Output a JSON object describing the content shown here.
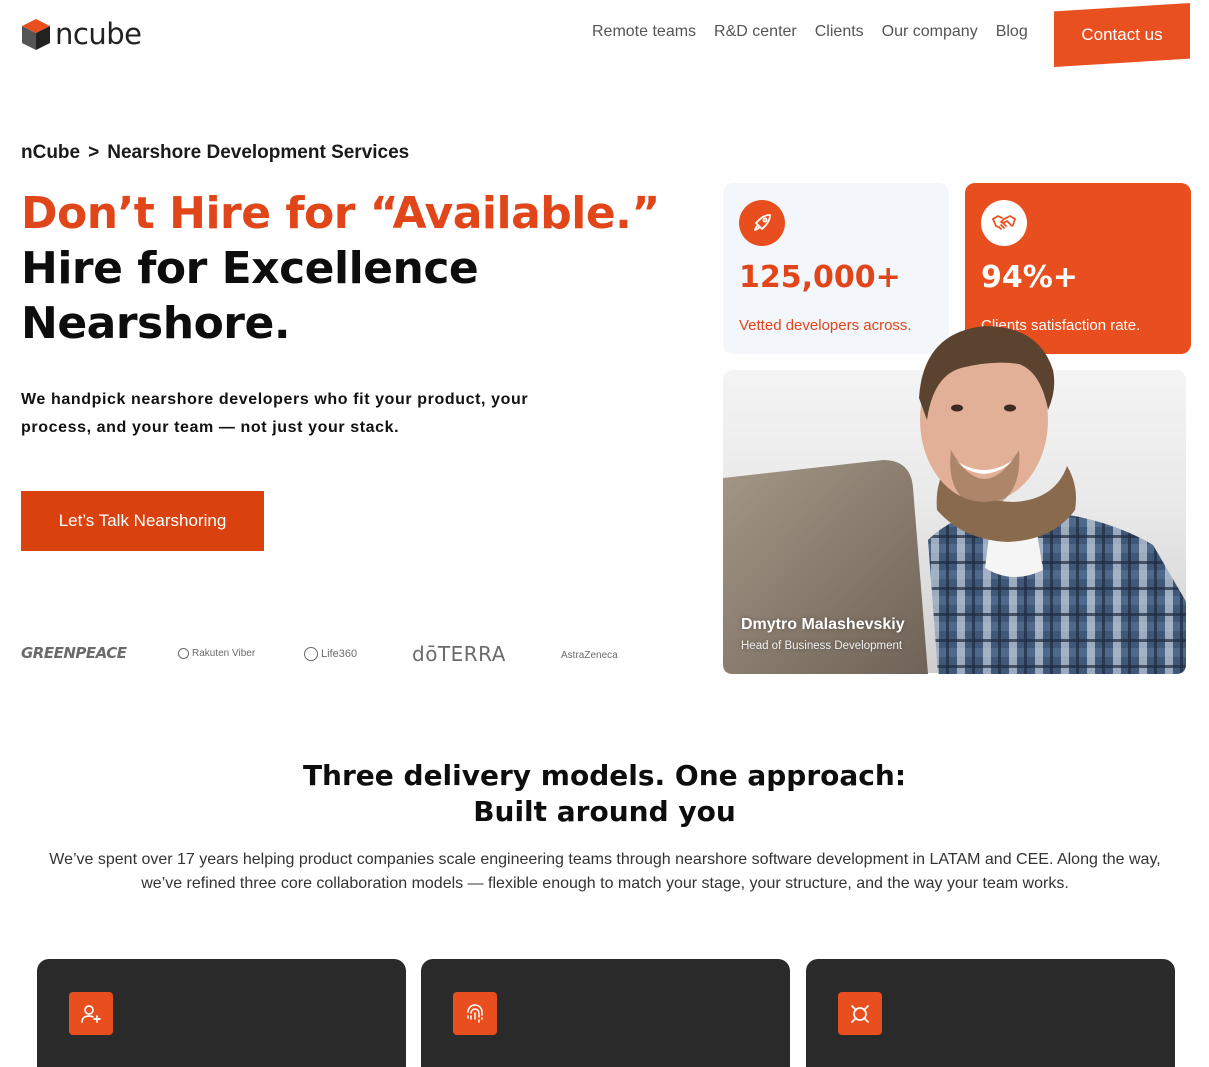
{
  "brand": {
    "name": "ncube",
    "accent_color": "#e94f1e"
  },
  "nav": {
    "items": [
      {
        "label": "Remote teams"
      },
      {
        "label": "R&D center"
      },
      {
        "label": "Clients"
      },
      {
        "label": "Our company"
      },
      {
        "label": "Blog"
      }
    ],
    "contact_label": "Contact us"
  },
  "breadcrumb": {
    "home": "nCube",
    "separator": ">",
    "current": "Nearshore Development Services"
  },
  "hero": {
    "title_accent": "Don’t Hire for “Available.”",
    "title_line2": "Hire for Excellence",
    "title_line3": "Nearshore.",
    "subtitle": "We handpick nearshore developers who fit your product, your process, and your team — not just your stack.",
    "cta_label": "Let’s Talk Nearshoring"
  },
  "client_logos": {
    "greenpeace": "GREENPEACE",
    "viber": "Rakuten Viber",
    "life360": "Life360",
    "doterra": "dōTERRA",
    "astrazeneca": "AstraZeneca"
  },
  "stats": [
    {
      "icon": "rocket-icon",
      "value": "125,000+",
      "caption": "Vetted developers across."
    },
    {
      "icon": "handshake-icon",
      "value": "94%+",
      "caption": "Clients satisfaction rate."
    }
  ],
  "person": {
    "name": "Dmytro Malashevskiy",
    "role": "Head of Business Development"
  },
  "delivery": {
    "title_line1": "Three delivery models. One approach:",
    "title_line2": "Built around you",
    "text": "We’ve spent over 17 years helping product companies scale engineering teams through nearshore software development in LATAM and CEE. Along the way, we’ve refined three core collaboration models — flexible enough to match your stage, your structure, and the way your team works.",
    "models": [
      {
        "icon": "user-plus-icon"
      },
      {
        "icon": "fingerprint-icon"
      },
      {
        "icon": "target-icon"
      }
    ]
  }
}
